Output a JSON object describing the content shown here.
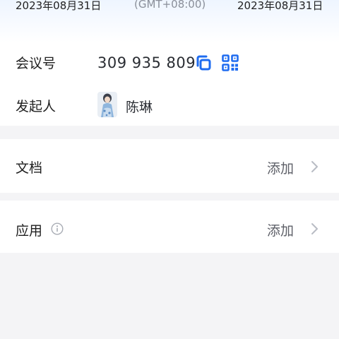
{
  "time_strip": {
    "start_date": "2023年08月31日",
    "timezone": "(GMT+08:00)",
    "end_date": "2023年08月31日"
  },
  "meeting": {
    "id_label": "会议号",
    "id_value": "309 935 809",
    "copy_icon": "copy-icon",
    "qr_icon": "qr-code-icon"
  },
  "host": {
    "label": "发起人",
    "name": "陈琳",
    "avatar": "avatar-image"
  },
  "sections": {
    "docs": {
      "title": "文档",
      "action": "添加"
    },
    "apps": {
      "title": "应用",
      "action": "添加",
      "info_icon": "info-icon"
    }
  },
  "colors": {
    "accent": "#1f6cf0",
    "page_bg": "#f4f4f6",
    "card_bg": "#ffffff",
    "secondary_text": "#8a8f99",
    "chevron": "#b8bcc4"
  }
}
